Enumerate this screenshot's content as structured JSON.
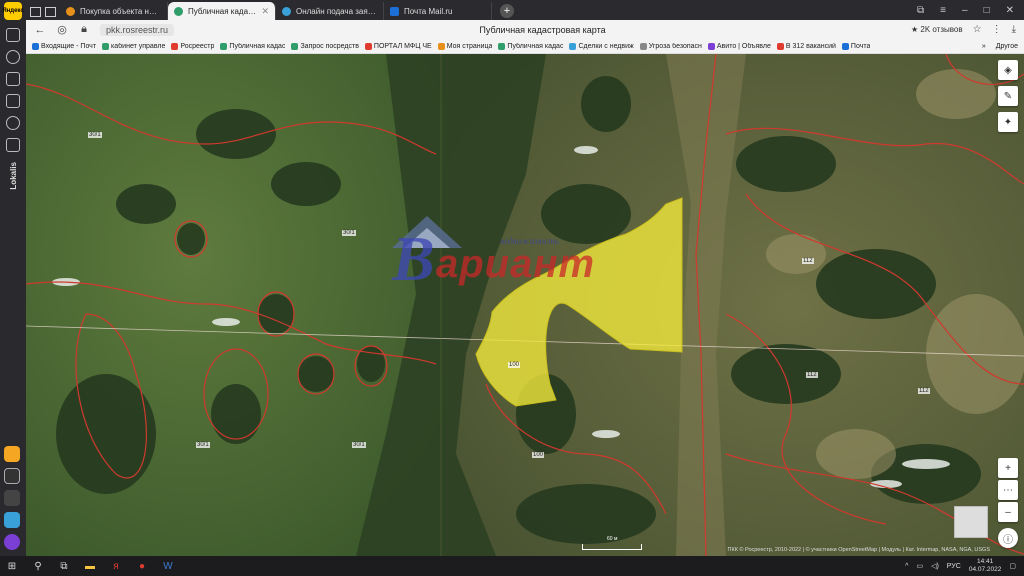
{
  "sidebar": {
    "logo_text": "Яндекс",
    "vertical_label": "Lokalis"
  },
  "tabs": [
    {
      "label": "Покупка объекта недвиж",
      "color": "#e8901c",
      "active": false
    },
    {
      "label": "Публичная кадастровая",
      "color": "#2f9e6a",
      "active": true
    },
    {
      "label": "Онлайн подача заявки на",
      "color": "#3aa0d8",
      "active": false
    },
    {
      "label": "Почта Mail.ru",
      "color": "#1b6fd6",
      "active": false
    }
  ],
  "address_bar": {
    "url": "pkk.rosreestr.ru",
    "page_title": "Публичная кадастровая карта",
    "reviews": "★ 2K отзывов"
  },
  "bookmarks": [
    {
      "label": "Входящие - Почт",
      "color": "#1b6fd6"
    },
    {
      "label": "кабинет управле",
      "color": "#2f9e6a"
    },
    {
      "label": "Росреестр",
      "color": "#e03b2e"
    },
    {
      "label": "Публичная кадас",
      "color": "#2f9e6a"
    },
    {
      "label": "Запрос посредств",
      "color": "#2f9e6a"
    },
    {
      "label": "ПОРТАЛ МФЦ ЧЕ",
      "color": "#e03b2e"
    },
    {
      "label": "Моя страница",
      "color": "#e8901c"
    },
    {
      "label": "Публичная кадас",
      "color": "#2f9e6a"
    },
    {
      "label": "Сделки с недвиж",
      "color": "#3aa0d8"
    },
    {
      "label": "Угроза безопасн",
      "color": "#888888"
    },
    {
      "label": "Авито | Объявле",
      "color": "#7b3fd6"
    },
    {
      "label": "В 312 вакансий",
      "color": "#e03b2e"
    },
    {
      "label": "Почта",
      "color": "#1b6fd6"
    }
  ],
  "bookmarks_more": "Другое",
  "map": {
    "parcel_labels": [
      "30/1",
      "30/1",
      "30/1",
      "30/1",
      "100",
      "112",
      "112",
      "112",
      "100"
    ],
    "attribution": "ПКК © Росреестр, 2010-2022 | © участники OpenStreetMap | Модуль | Кат. Intermap, NASA, NGA, USGS",
    "scale_label": "60 м",
    "colors": {
      "selected_parcel": "#f5ec3c",
      "boundary": "#d0392e"
    }
  },
  "watermark": {
    "big_letter": "В",
    "word": "ариант",
    "subtitle": "недвижимость"
  },
  "taskbar": {
    "lang": "РУС",
    "time": "14:41",
    "date": "04.07.2022"
  }
}
